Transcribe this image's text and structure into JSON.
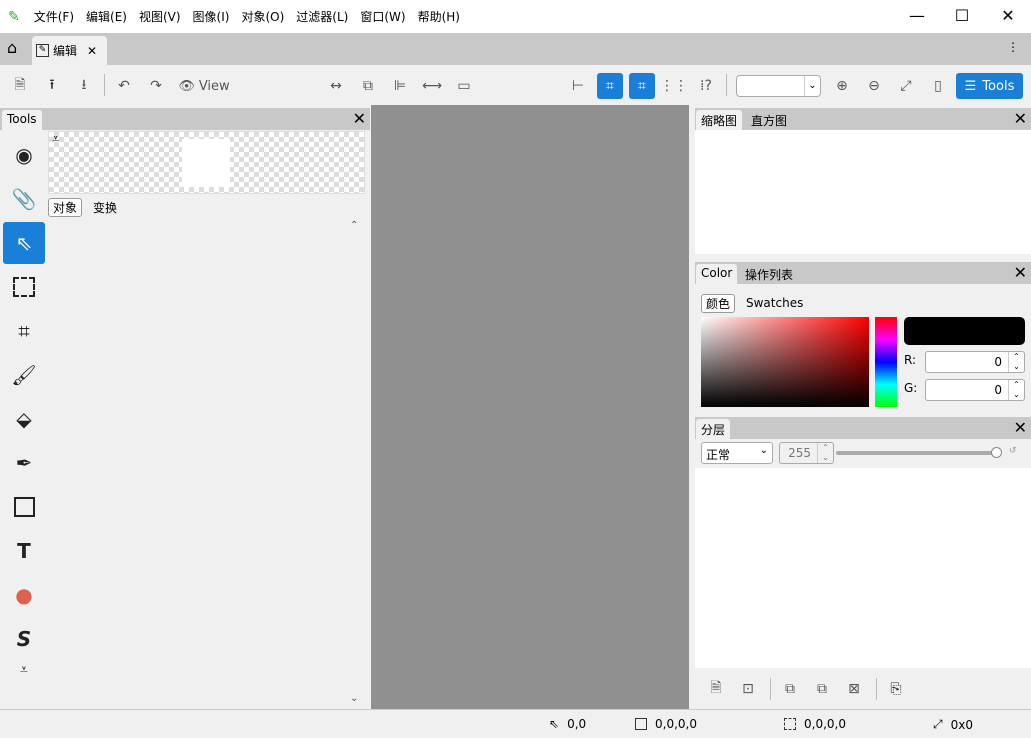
{
  "app": {
    "menus": [
      "文件(F)",
      "编辑(E)",
      "视图(V)",
      "图像(I)",
      "对象(O)",
      "过滤器(L)",
      "窗口(W)",
      "帮助(H)"
    ]
  },
  "tabs": {
    "doc_tab": "编辑"
  },
  "toolbar": {
    "view_label": "View",
    "tools_label": "Tools",
    "zoom_value": ""
  },
  "left_panel": {
    "tab": "Tools",
    "sub_tabs": [
      "对象",
      "变换"
    ]
  },
  "right_panel": {
    "thumb_tabs": [
      "缩略图",
      "直方图"
    ],
    "color_tabs": [
      "Color",
      "操作列表"
    ],
    "color_subtabs": [
      "颜色",
      "Swatches"
    ],
    "r_label": "R:",
    "r_value": "0",
    "g_label": "G:",
    "g_value": "0",
    "current_color": "#000000",
    "layers_tab": "分层",
    "blend_mode": "正常",
    "opacity": "255",
    "opacity_fraction": 1.0
  },
  "status": {
    "cursor": "0,0",
    "bounds": "0,0,0,0",
    "selection": "0,0,0,0",
    "size": "0x0"
  },
  "colors": {
    "accent": "#1a7fd9",
    "canvas_bg": "#909090"
  }
}
